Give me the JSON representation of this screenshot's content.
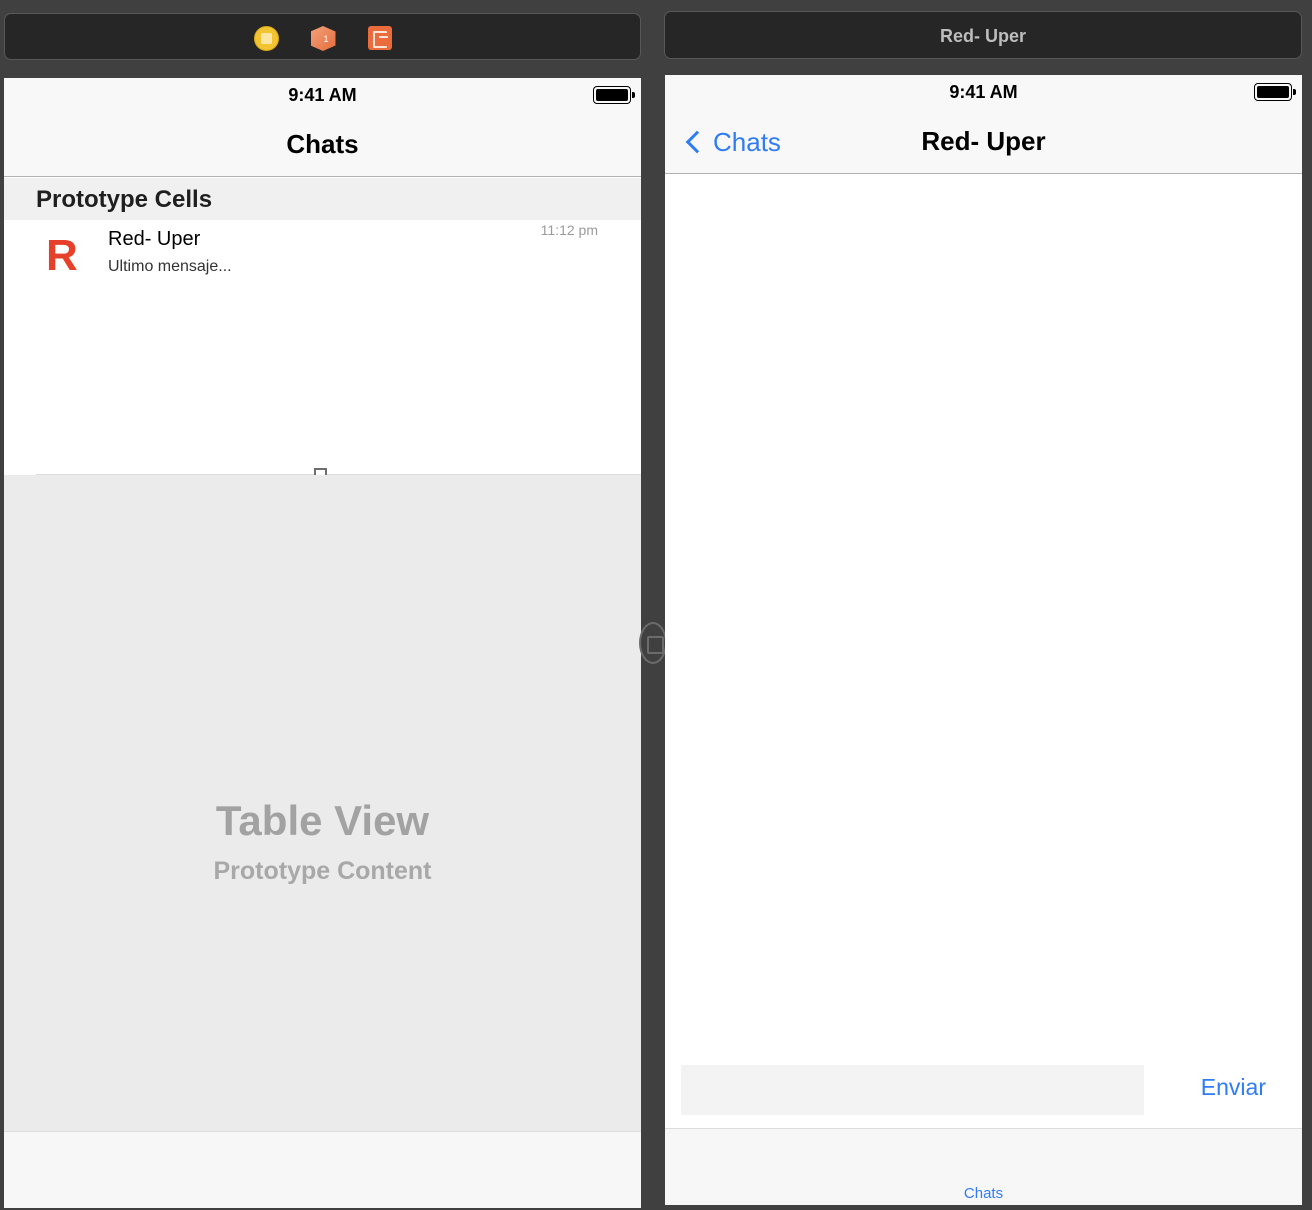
{
  "left_scene": {
    "icons": [
      "view-controller-icon",
      "first-responder-icon",
      "exit-icon"
    ]
  },
  "right_scene": {
    "bar_title": "Red- Uper"
  },
  "status_bar": {
    "time": "9:41 AM"
  },
  "chats_screen": {
    "title": "Chats",
    "section_header": "Prototype Cells",
    "cell": {
      "avatar_letter": "R",
      "name": "Red- Uper",
      "last_message": "Ultimo mensaje...",
      "time": "11:12 pm"
    },
    "placeholder": {
      "title": "Table View",
      "subtitle": "Prototype Content"
    }
  },
  "chat_screen": {
    "back_label": "Chats",
    "title": "Red- Uper",
    "input_value": "",
    "send_label": "Enviar",
    "tab_label": "Chats"
  },
  "colors": {
    "canvas": "#404040",
    "accent": "#2f7cf6",
    "avatar_red": "#e7402a"
  }
}
